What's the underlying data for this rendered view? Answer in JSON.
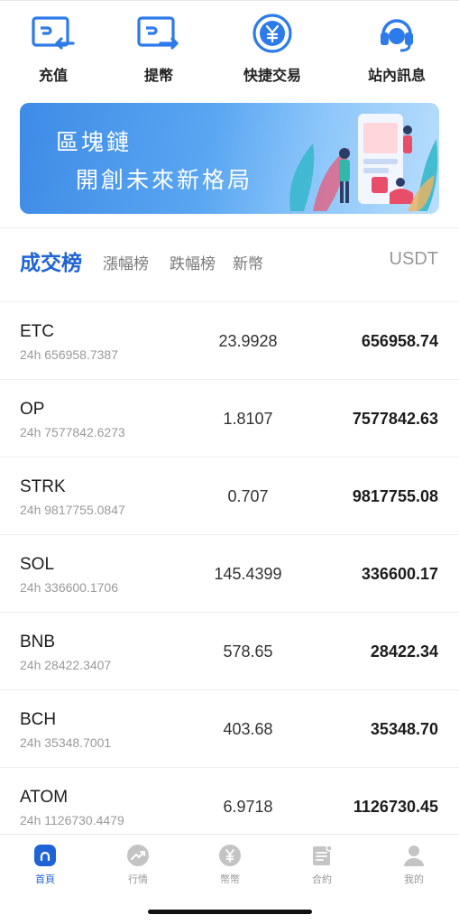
{
  "quick_actions": [
    {
      "label": "充值",
      "icon": "deposit-icon"
    },
    {
      "label": "提幣",
      "icon": "withdraw-icon"
    },
    {
      "label": "快捷交易",
      "icon": "yuan-exchange-icon"
    },
    {
      "label": "站內訊息",
      "icon": "headset-icon"
    }
  ],
  "banner": {
    "line1": "區塊鏈",
    "line2": "開創未來新格局"
  },
  "tabs": {
    "items": [
      "成交榜",
      "漲幅榜",
      "跌幅榜",
      "新幣"
    ],
    "active": "成交榜",
    "unit": "USDT"
  },
  "markets": [
    {
      "symbol": "ETC",
      "volume": "24h 656958.7387",
      "price": "23.9928",
      "amount": "656958.74"
    },
    {
      "symbol": "OP",
      "volume": "24h 7577842.6273",
      "price": "1.8107",
      "amount": "7577842.63"
    },
    {
      "symbol": "STRK",
      "volume": "24h 9817755.0847",
      "price": "0.707",
      "amount": "9817755.08"
    },
    {
      "symbol": "SOL",
      "volume": "24h 336600.1706",
      "price": "145.4399",
      "amount": "336600.17"
    },
    {
      "symbol": "BNB",
      "volume": "24h 28422.3407",
      "price": "578.65",
      "amount": "28422.34"
    },
    {
      "symbol": "BCH",
      "volume": "24h 35348.7001",
      "price": "403.68",
      "amount": "35348.70"
    },
    {
      "symbol": "ATOM",
      "volume": "24h 1126730.4479",
      "price": "6.9718",
      "amount": "1126730.45"
    }
  ],
  "bottom_nav": [
    {
      "label": "首頁",
      "icon": "home-icon",
      "active": true
    },
    {
      "label": "行情",
      "icon": "trend-icon",
      "active": false
    },
    {
      "label": "幣幣",
      "icon": "yuan-coin-icon",
      "active": false
    },
    {
      "label": "合約",
      "icon": "contract-icon",
      "active": false
    },
    {
      "label": "我的",
      "icon": "user-icon",
      "active": false
    }
  ],
  "colors": {
    "accent": "#1f63d6",
    "icon_blue": "#2d7bea",
    "muted": "#999999"
  }
}
